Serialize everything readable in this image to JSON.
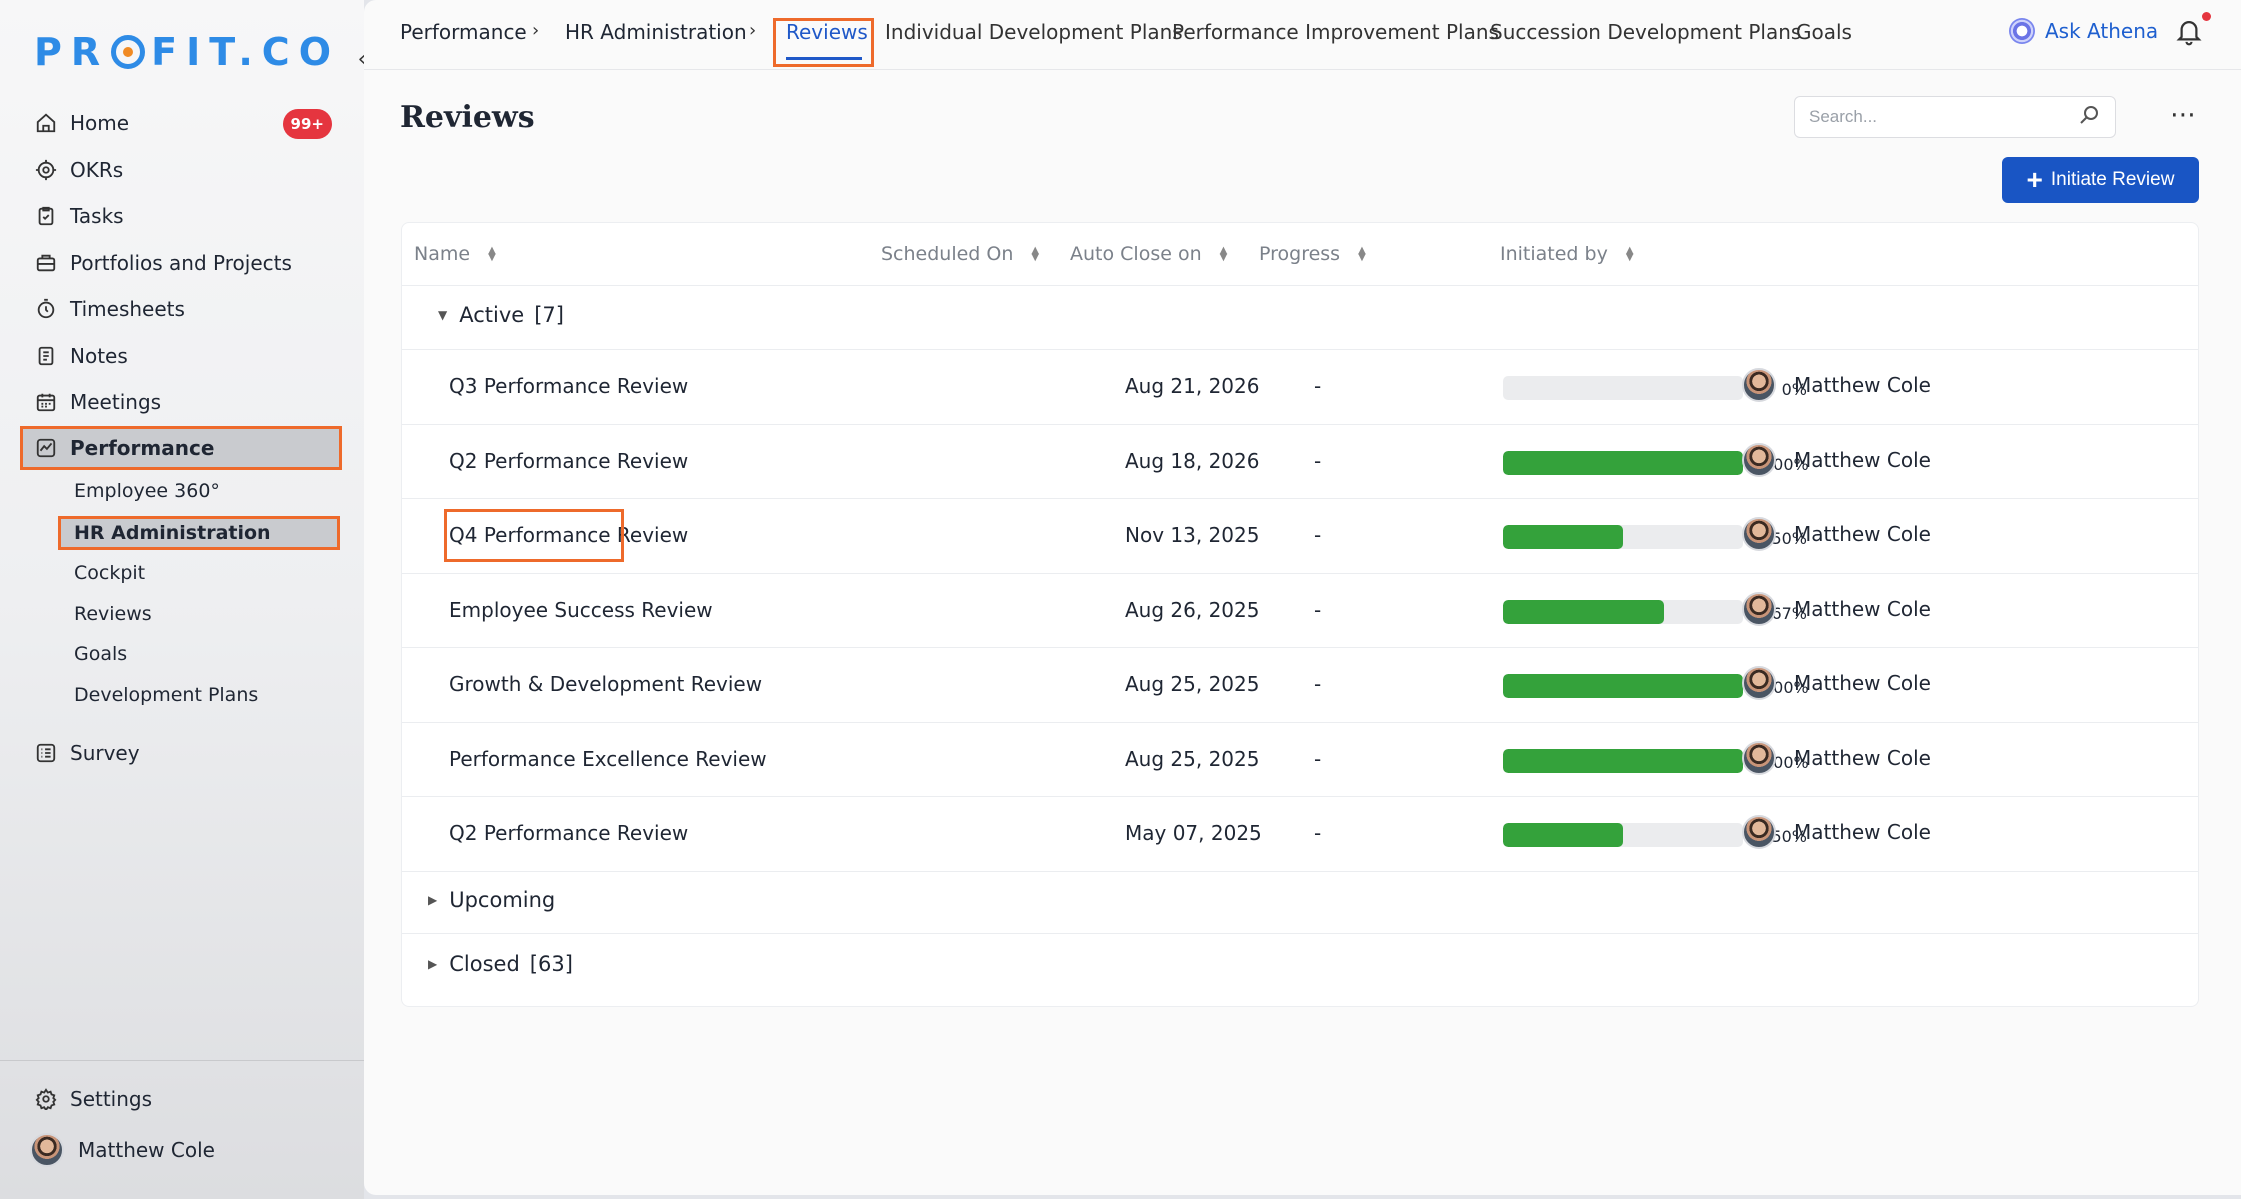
{
  "app": {
    "logo_text_left": "PR",
    "logo_text_right": "FIT.CO",
    "brand_color": "#2e8be6",
    "accent_color": "#ee6a2b"
  },
  "sidebar": {
    "items": [
      {
        "label": "Home",
        "icon": "home-icon",
        "badge": "99+"
      },
      {
        "label": "OKRs",
        "icon": "target-icon"
      },
      {
        "label": "Tasks",
        "icon": "clipboard-check-icon"
      },
      {
        "label": "Portfolios and Projects",
        "icon": "briefcase-icon"
      },
      {
        "label": "Timesheets",
        "icon": "stopwatch-icon"
      },
      {
        "label": "Notes",
        "icon": "notes-icon"
      },
      {
        "label": "Meetings",
        "icon": "calendar-icon"
      },
      {
        "label": "Performance",
        "icon": "performance-chart-icon",
        "active": true
      }
    ],
    "performance_subitems": [
      {
        "label": "Employee 360°"
      },
      {
        "label": "HR Administration",
        "active": true
      },
      {
        "label": "Cockpit"
      },
      {
        "label": "Reviews"
      },
      {
        "label": "Goals"
      },
      {
        "label": "Development Plans"
      }
    ],
    "survey": {
      "label": "Survey",
      "icon": "survey-list-icon"
    },
    "settings": {
      "label": "Settings",
      "icon": "gear-icon"
    },
    "user": {
      "name": "Matthew Cole"
    }
  },
  "topnav": {
    "breadcrumb": [
      "Performance",
      "HR Administration"
    ],
    "breadcrumb_separator": "›",
    "tabs": [
      {
        "label": "Reviews",
        "active": true
      },
      {
        "label": "Individual Development Plans"
      },
      {
        "label": "Performance Improvement Plans"
      },
      {
        "label": "Succession Development Plans"
      },
      {
        "label": "Goals"
      }
    ],
    "ask_athena": "Ask Athena"
  },
  "page": {
    "title": "Reviews",
    "search_placeholder": "Search...",
    "initiate_button": "Initiate Review",
    "more_glyph": "⋯"
  },
  "table": {
    "columns": [
      "Name",
      "Scheduled On",
      "Auto Close on",
      "Progress",
      "Initiated by"
    ],
    "groups": {
      "active": {
        "label": "Active",
        "count": "[7]",
        "expanded": true
      },
      "upcoming": {
        "label": "Upcoming",
        "count": "",
        "expanded": false
      },
      "closed": {
        "label": "Closed",
        "count": "[63]",
        "expanded": false
      }
    },
    "rows": [
      {
        "name": "Q3 Performance Review",
        "scheduled": "Aug 21, 2026",
        "auto_close": "-",
        "progress": 0,
        "progress_label": "0%",
        "initiated_by": "Matthew Cole"
      },
      {
        "name": "Q2 Performance Review",
        "scheduled": "Aug 18, 2026",
        "auto_close": "-",
        "progress": 100,
        "progress_label": "100%",
        "initiated_by": "Matthew Cole"
      },
      {
        "name": "Q4 Performance Review",
        "scheduled": "Nov 13, 2025",
        "auto_close": "-",
        "progress": 50,
        "progress_label": "50%",
        "initiated_by": "Matthew Cole",
        "highlighted": true
      },
      {
        "name": "Employee Success Review",
        "scheduled": "Aug 26, 2025",
        "auto_close": "-",
        "progress": 67,
        "progress_label": "67%",
        "initiated_by": "Matthew Cole"
      },
      {
        "name": "Growth & Development Review",
        "scheduled": "Aug 25, 2025",
        "auto_close": "-",
        "progress": 100,
        "progress_label": "100%",
        "initiated_by": "Matthew Cole"
      },
      {
        "name": "Performance Excellence Review",
        "scheduled": "Aug 25, 2025",
        "auto_close": "-",
        "progress": 100,
        "progress_label": "100%",
        "initiated_by": "Matthew Cole"
      },
      {
        "name": "Q2 Performance Review",
        "scheduled": "May 07, 2025",
        "auto_close": "-",
        "progress": 50,
        "progress_label": "50%",
        "initiated_by": "Matthew Cole"
      }
    ],
    "progress_color": "#34a23b"
  }
}
